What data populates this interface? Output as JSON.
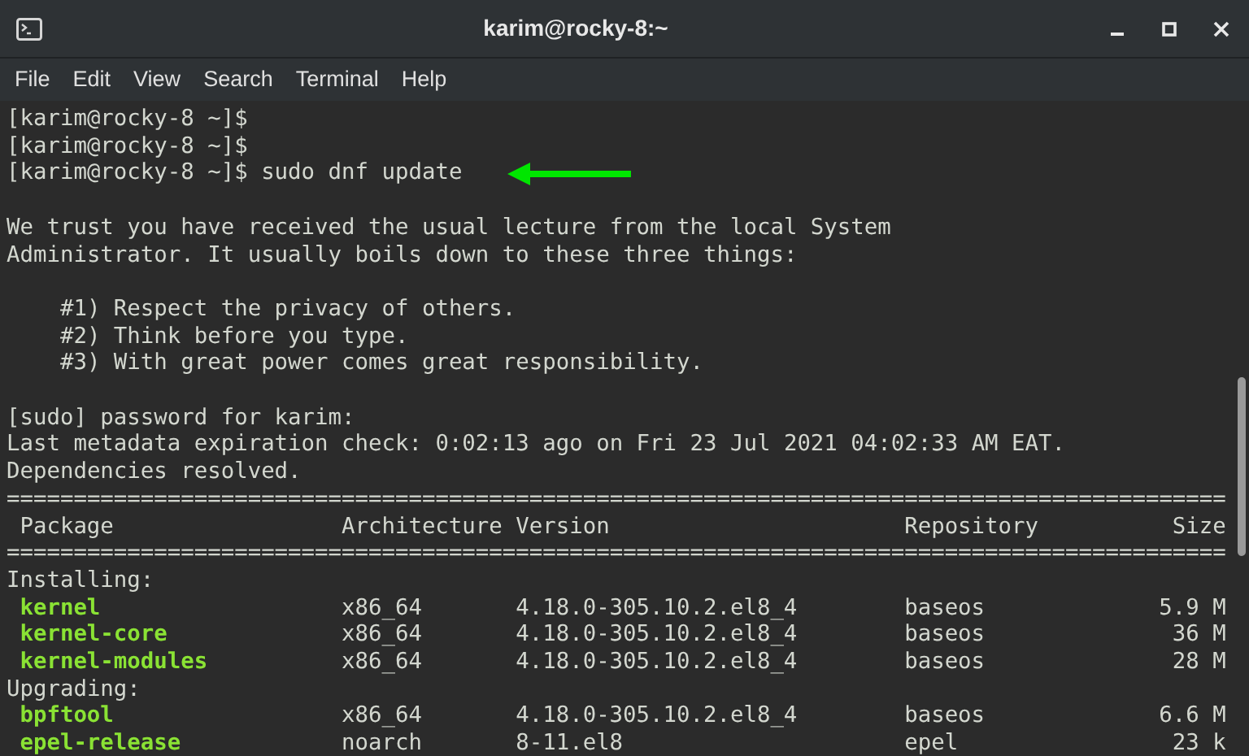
{
  "window": {
    "title": "karim@rocky-8:~"
  },
  "menu": [
    "File",
    "Edit",
    "View",
    "Search",
    "Terminal",
    "Help"
  ],
  "terminal": {
    "lines": [
      {
        "kind": "text",
        "text": "[karim@rocky-8 ~]$"
      },
      {
        "kind": "text",
        "text": "[karim@rocky-8 ~]$"
      },
      {
        "kind": "command",
        "text": "[karim@rocky-8 ~]$ sudo dnf update"
      },
      {
        "kind": "blank"
      },
      {
        "kind": "text",
        "text": "We trust you have received the usual lecture from the local System"
      },
      {
        "kind": "text",
        "text": "Administrator. It usually boils down to these three things:"
      },
      {
        "kind": "blank"
      },
      {
        "kind": "text",
        "text": "    #1) Respect the privacy of others."
      },
      {
        "kind": "text",
        "text": "    #2) Think before you type."
      },
      {
        "kind": "text",
        "text": "    #3) With great power comes great responsibility."
      },
      {
        "kind": "blank"
      },
      {
        "kind": "text",
        "text": "[sudo] password for karim:"
      },
      {
        "kind": "text",
        "text": "Last metadata expiration check: 0:02:13 ago on Fri 23 Jul 2021 04:02:33 AM EAT."
      },
      {
        "kind": "text",
        "text": "Dependencies resolved."
      },
      {
        "kind": "separator",
        "text": "==========================================================================================="
      },
      {
        "kind": "header",
        "cells": [
          "Package",
          "Architecture",
          "Version",
          "Repository",
          "Size"
        ]
      },
      {
        "kind": "separator",
        "text": "==========================================================================================="
      },
      {
        "kind": "text",
        "text": "Installing:"
      },
      {
        "kind": "package",
        "cells": [
          "kernel",
          "x86_64",
          "4.18.0-305.10.2.el8_4",
          "baseos",
          "5.9 M"
        ]
      },
      {
        "kind": "package",
        "cells": [
          "kernel-core",
          "x86_64",
          "4.18.0-305.10.2.el8_4",
          "baseos",
          "36 M"
        ]
      },
      {
        "kind": "package",
        "cells": [
          "kernel-modules",
          "x86_64",
          "4.18.0-305.10.2.el8_4",
          "baseos",
          "28 M"
        ]
      },
      {
        "kind": "text",
        "text": "Upgrading:"
      },
      {
        "kind": "package",
        "cells": [
          "bpftool",
          "x86_64",
          "4.18.0-305.10.2.el8_4",
          "baseos",
          "6.6 M"
        ]
      },
      {
        "kind": "package",
        "cells": [
          "epel-release",
          "noarch",
          "8-11.el8",
          "epel",
          "23 k"
        ]
      }
    ]
  }
}
